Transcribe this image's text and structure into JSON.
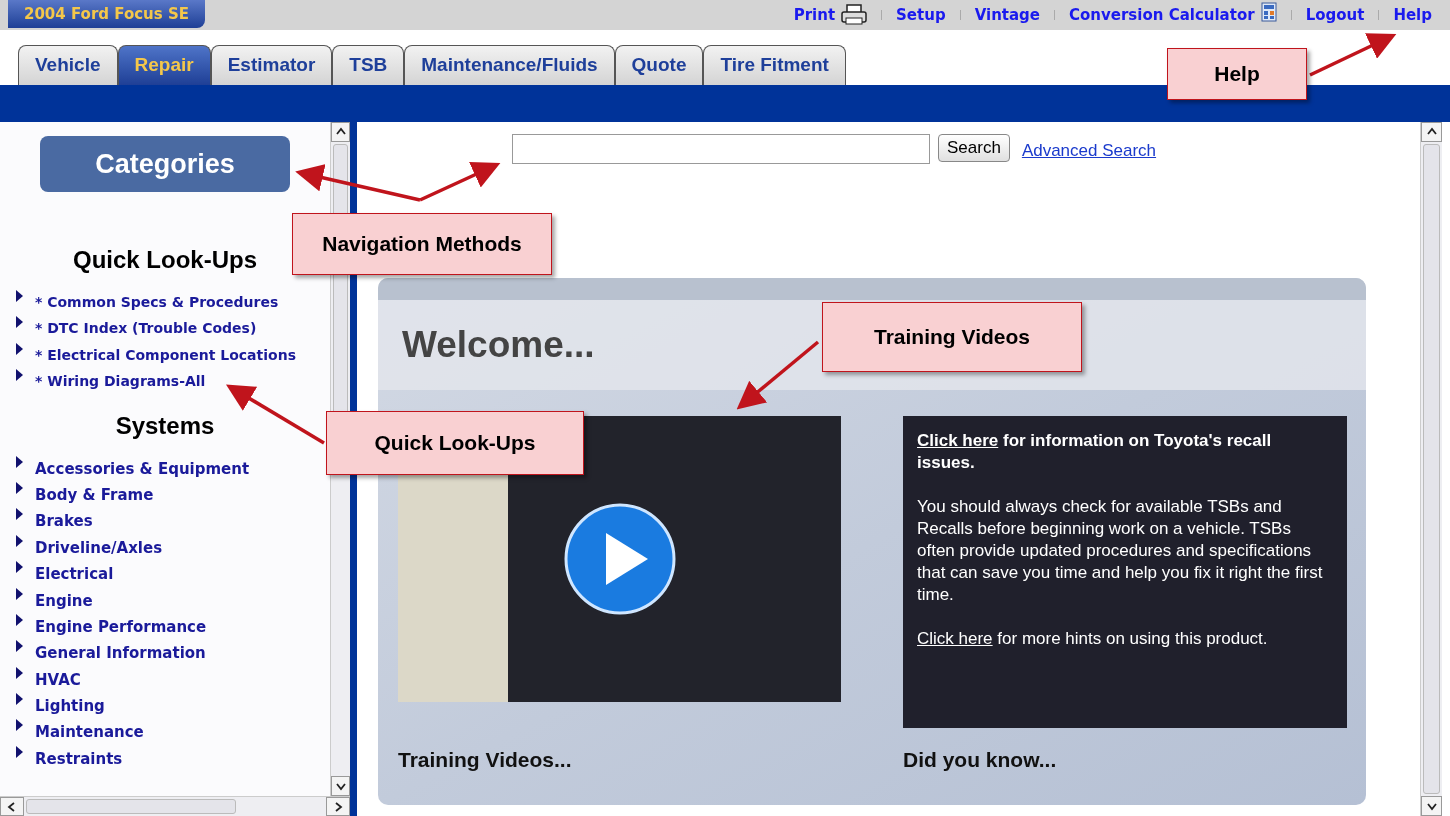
{
  "vehicle": "2004 Ford Focus SE",
  "top_links": [
    {
      "label": "Print",
      "kind": "printer"
    },
    {
      "label": "Setup",
      "kind": "plain"
    },
    {
      "label": "Vintage",
      "kind": "plain"
    },
    {
      "label": "Conversion Calculator",
      "kind": "calculator"
    },
    {
      "label": "Logout",
      "kind": "plain"
    },
    {
      "label": "Help",
      "kind": "plain"
    }
  ],
  "tabs": [
    {
      "label": "Vehicle",
      "selected": false
    },
    {
      "label": "Repair",
      "selected": true
    },
    {
      "label": "Estimator",
      "selected": false
    },
    {
      "label": "TSB",
      "selected": false
    },
    {
      "label": "Maintenance/Fluids",
      "selected": false
    },
    {
      "label": "Quote",
      "selected": false
    },
    {
      "label": "Tire Fitment",
      "selected": false
    }
  ],
  "sidebar": {
    "button": "Categories",
    "sections": [
      {
        "heading": "Quick Look-Ups",
        "items": [
          "* Common Specs & Procedures",
          "* DTC Index (Trouble Codes)",
          "* Electrical Component Locations",
          "* Wiring Diagrams-All"
        ]
      },
      {
        "heading": "Systems",
        "items": [
          "Accessories & Equipment",
          "Body & Frame",
          "Brakes",
          "Driveline/Axles",
          "Electrical",
          "Engine",
          "Engine Performance",
          "General Information",
          "HVAC",
          "Lighting",
          "Maintenance",
          "Restraints"
        ]
      }
    ]
  },
  "search": {
    "button": "Search",
    "link": "Advanced Search"
  },
  "welcome": {
    "title": "Welcome...",
    "video_caption": "Training Videos...",
    "info_caption": "Did you know...",
    "paragraphs": [
      {
        "link": "Click here",
        "text": " for information on Toyota's recall issues.",
        "emphasis": true
      },
      {
        "text": "You should always check for available TSBs and Recalls before beginning work on a vehicle. TSBs often provide updated procedures and specifications that can save you time and help you fix it right the first time.",
        "emphasis": false
      },
      {
        "link": "Click here",
        "text": " for more hints on using this product.",
        "emphasis": false
      }
    ]
  },
  "callouts": [
    {
      "label": "Help"
    },
    {
      "label": "Navigation Methods"
    },
    {
      "label": "Training Videos"
    },
    {
      "label": "Quick Look-Ups"
    }
  ]
}
